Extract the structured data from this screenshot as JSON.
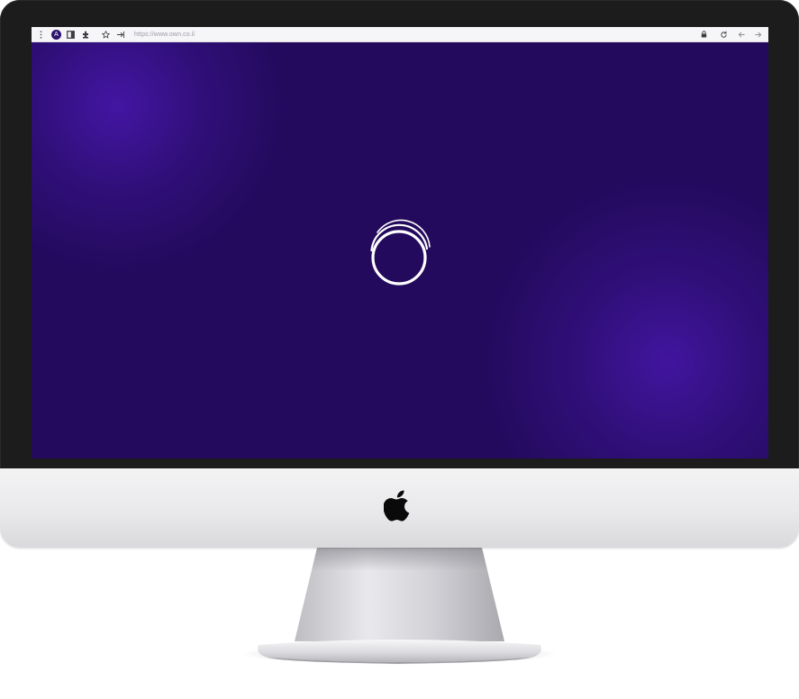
{
  "browser": {
    "url": "https://www.own.co.il",
    "profile_initial": "A",
    "icons": [
      "menu-dots-icon",
      "profile-avatar",
      "sidebar-icon",
      "extensions-icon",
      "star-icon",
      "share-icon",
      "lock-icon",
      "reload-icon",
      "back-icon",
      "forward-icon"
    ]
  },
  "page": {
    "state": "loading",
    "background_color": "#230a5c",
    "glow_color": "#4818af",
    "spinner_color": "#ffffff"
  },
  "device": {
    "bezel_color": "#1c1c1c",
    "chin_color": "#ececee",
    "logo_icon": "apple-logo-icon"
  }
}
